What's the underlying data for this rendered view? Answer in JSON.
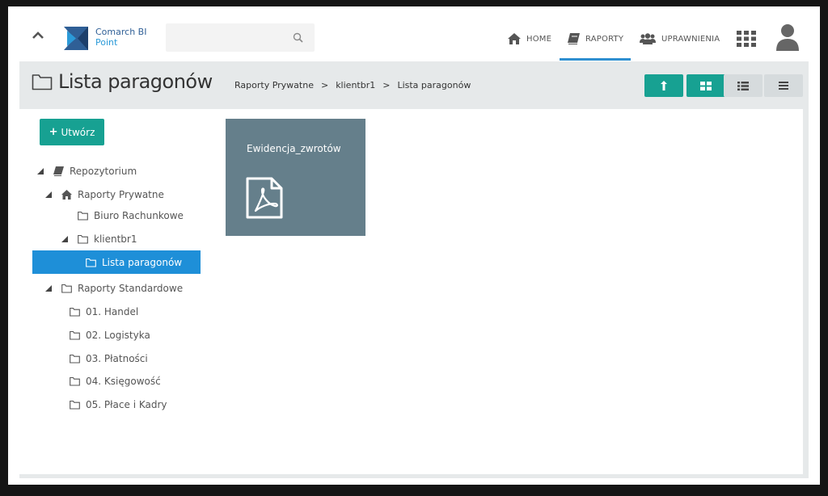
{
  "brand": {
    "line1": "Comarch BI",
    "line2": "Point"
  },
  "search": {
    "placeholder": ""
  },
  "nav": {
    "home": "HOME",
    "raporty": "RAPORTY",
    "uprawnienia": "UPRAWNIENIA"
  },
  "page": {
    "title": "Lista paragonów"
  },
  "breadcrumb": {
    "items": [
      "Raporty Prywatne",
      "klientbr1",
      "Lista paragonów"
    ],
    "separator": ">"
  },
  "toolbar": {
    "up_icon": "arrow-up-icon",
    "tiles_icon": "grid-view-icon",
    "list_icon": "list-view-icon",
    "menu_icon": "hamburger-icon"
  },
  "create_button": {
    "label": "Utwórz",
    "icon": "plus-icon"
  },
  "tree": {
    "root": "Repozytorium",
    "private": "Raporty Prywatne",
    "biuro": "Biuro Rachunkowe",
    "klient": "klientbr1",
    "lista": "Lista paragonów",
    "standard": "Raporty Standardowe",
    "s1": "01. Handel",
    "s2": "02. Logistyka",
    "s3": "03. Płatności",
    "s4": "04. Księgowość",
    "s5": "05. Płace i Kadry"
  },
  "tiles": [
    {
      "title": "Ewidencja_zwrotów",
      "icon": "pdf-icon"
    }
  ],
  "colors": {
    "accent_teal": "#17a192",
    "accent_blue": "#1e8fd8",
    "tile_bg": "#657f8b",
    "header_band": "#e6e9ea"
  }
}
